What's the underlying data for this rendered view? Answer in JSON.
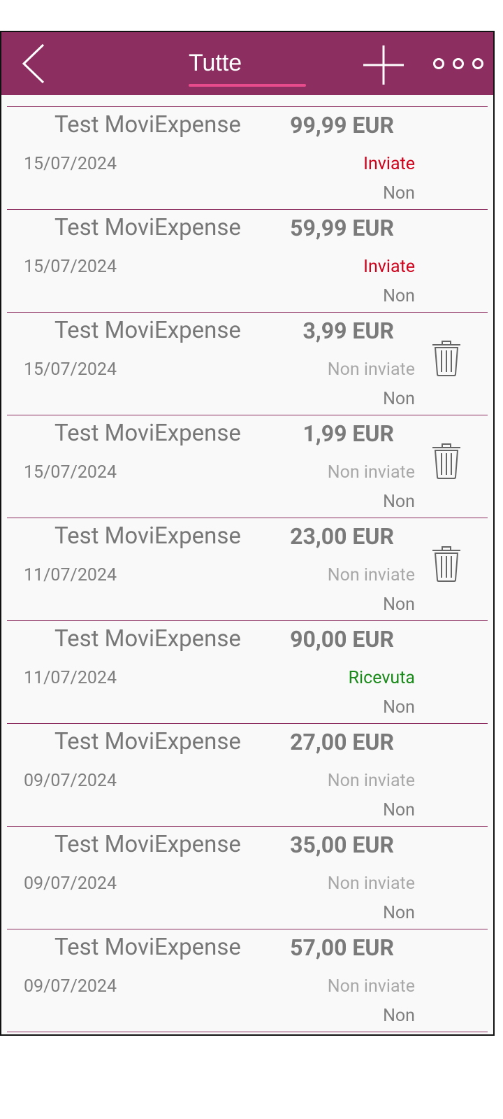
{
  "header": {
    "title": "Tutte",
    "back_icon": "chevron-left-icon",
    "add_icon": "plus-icon",
    "more_icon": "more-horizontal-icon",
    "bar_color": "#8c2e5f",
    "underline_color": "#e84b8b"
  },
  "status_colors": {
    "Inviate": "#d0021b",
    "Non inviate": "#a8a8a8",
    "Ricevuta": "#1a8a1a"
  },
  "expenses": [
    {
      "name": "Test MoviExpense",
      "amount": "99,99 EUR",
      "date": "15/07/2024",
      "status": "Inviate",
      "flag": "Non",
      "deletable": false
    },
    {
      "name": "Test MoviExpense",
      "amount": "59,99 EUR",
      "date": "15/07/2024",
      "status": "Inviate",
      "flag": "Non",
      "deletable": false
    },
    {
      "name": "Test MoviExpense",
      "amount": "3,99 EUR",
      "date": "15/07/2024",
      "status": "Non inviate",
      "flag": "Non",
      "deletable": true
    },
    {
      "name": "Test MoviExpense",
      "amount": "1,99 EUR",
      "date": "15/07/2024",
      "status": "Non inviate",
      "flag": "Non",
      "deletable": true
    },
    {
      "name": "Test MoviExpense",
      "amount": "23,00 EUR",
      "date": "11/07/2024",
      "status": "Non inviate",
      "flag": "Non",
      "deletable": true
    },
    {
      "name": "Test MoviExpense",
      "amount": "90,00 EUR",
      "date": "11/07/2024",
      "status": "Ricevuta",
      "flag": "Non",
      "deletable": false
    },
    {
      "name": "Test MoviExpense",
      "amount": "27,00 EUR",
      "date": "09/07/2024",
      "status": "Non inviate",
      "flag": "Non",
      "deletable": false
    },
    {
      "name": "Test MoviExpense",
      "amount": "35,00 EUR",
      "date": "09/07/2024",
      "status": "Non inviate",
      "flag": "Non",
      "deletable": false
    },
    {
      "name": "Test MoviExpense",
      "amount": "57,00 EUR",
      "date": "09/07/2024",
      "status": "Non inviate",
      "flag": "Non",
      "deletable": false
    }
  ]
}
